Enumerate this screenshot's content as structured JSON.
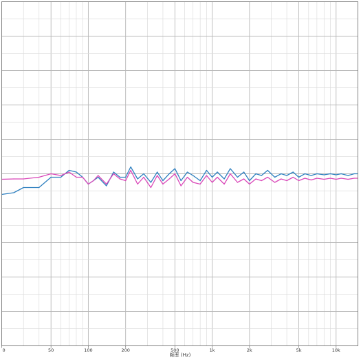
{
  "chart_data": {
    "type": "line",
    "title": "",
    "xlabel": "频率 (Hz)",
    "ylabel": "",
    "x_scale": "log",
    "xlim": [
      20,
      15000
    ],
    "ylim": [
      0,
      1
    ],
    "grid": true,
    "x_ticks": [
      {
        "value": 20,
        "label": "0"
      },
      {
        "value": 50,
        "label": "50"
      },
      {
        "value": 100,
        "label": "100"
      },
      {
        "value": 200,
        "label": "200"
      },
      {
        "value": 500,
        "label": "500"
      },
      {
        "value": 1000,
        "label": "1k"
      },
      {
        "value": 2000,
        "label": "2k"
      },
      {
        "value": 5000,
        "label": "5k"
      },
      {
        "value": 10000,
        "label": "10k"
      }
    ],
    "series": [
      {
        "color": "#2d7fbf",
        "x": [
          20,
          25,
          30,
          40,
          50,
          60,
          70,
          80,
          90,
          100,
          110,
          120,
          140,
          160,
          180,
          200,
          220,
          250,
          280,
          320,
          360,
          400,
          450,
          500,
          560,
          630,
          700,
          800,
          900,
          1000,
          1100,
          1250,
          1400,
          1600,
          1800,
          2000,
          2250,
          2500,
          2800,
          3200,
          3600,
          4000,
          4500,
          5000,
          5600,
          6300,
          7000,
          8000,
          9000,
          10000,
          11000,
          12500,
          14000,
          15000
        ],
        "y": [
          0.44,
          0.445,
          0.46,
          0.46,
          0.49,
          0.49,
          0.51,
          0.505,
          0.49,
          0.47,
          0.48,
          0.49,
          0.465,
          0.505,
          0.49,
          0.49,
          0.52,
          0.485,
          0.5,
          0.475,
          0.505,
          0.48,
          0.5,
          0.515,
          0.48,
          0.505,
          0.495,
          0.48,
          0.51,
          0.49,
          0.505,
          0.485,
          0.515,
          0.49,
          0.505,
          0.48,
          0.5,
          0.495,
          0.51,
          0.49,
          0.5,
          0.495,
          0.505,
          0.49,
          0.5,
          0.495,
          0.5,
          0.497,
          0.5,
          0.497,
          0.5,
          0.495,
          0.5,
          0.5
        ]
      },
      {
        "color": "#d946b8",
        "x": [
          20,
          25,
          30,
          40,
          50,
          60,
          70,
          80,
          90,
          100,
          110,
          120,
          140,
          160,
          180,
          200,
          220,
          250,
          280,
          320,
          360,
          400,
          450,
          500,
          560,
          630,
          700,
          800,
          900,
          1000,
          1100,
          1250,
          1400,
          1600,
          1800,
          2000,
          2250,
          2500,
          2800,
          3200,
          3600,
          4000,
          4500,
          5000,
          5600,
          6300,
          7000,
          8000,
          9000,
          10000,
          11000,
          12500,
          14000,
          15000
        ],
        "y": [
          0.484,
          0.485,
          0.485,
          0.49,
          0.5,
          0.495,
          0.505,
          0.49,
          0.49,
          0.47,
          0.48,
          0.495,
          0.47,
          0.5,
          0.485,
          0.48,
          0.51,
          0.47,
          0.49,
          0.46,
          0.495,
          0.47,
          0.485,
          0.5,
          0.465,
          0.49,
          0.475,
          0.47,
          0.495,
          0.475,
          0.49,
          0.47,
          0.5,
          0.475,
          0.485,
          0.47,
          0.485,
          0.48,
          0.49,
          0.475,
          0.485,
          0.48,
          0.49,
          0.48,
          0.487,
          0.482,
          0.487,
          0.484,
          0.487,
          0.484,
          0.487,
          0.484,
          0.487,
          0.487
        ]
      }
    ]
  }
}
